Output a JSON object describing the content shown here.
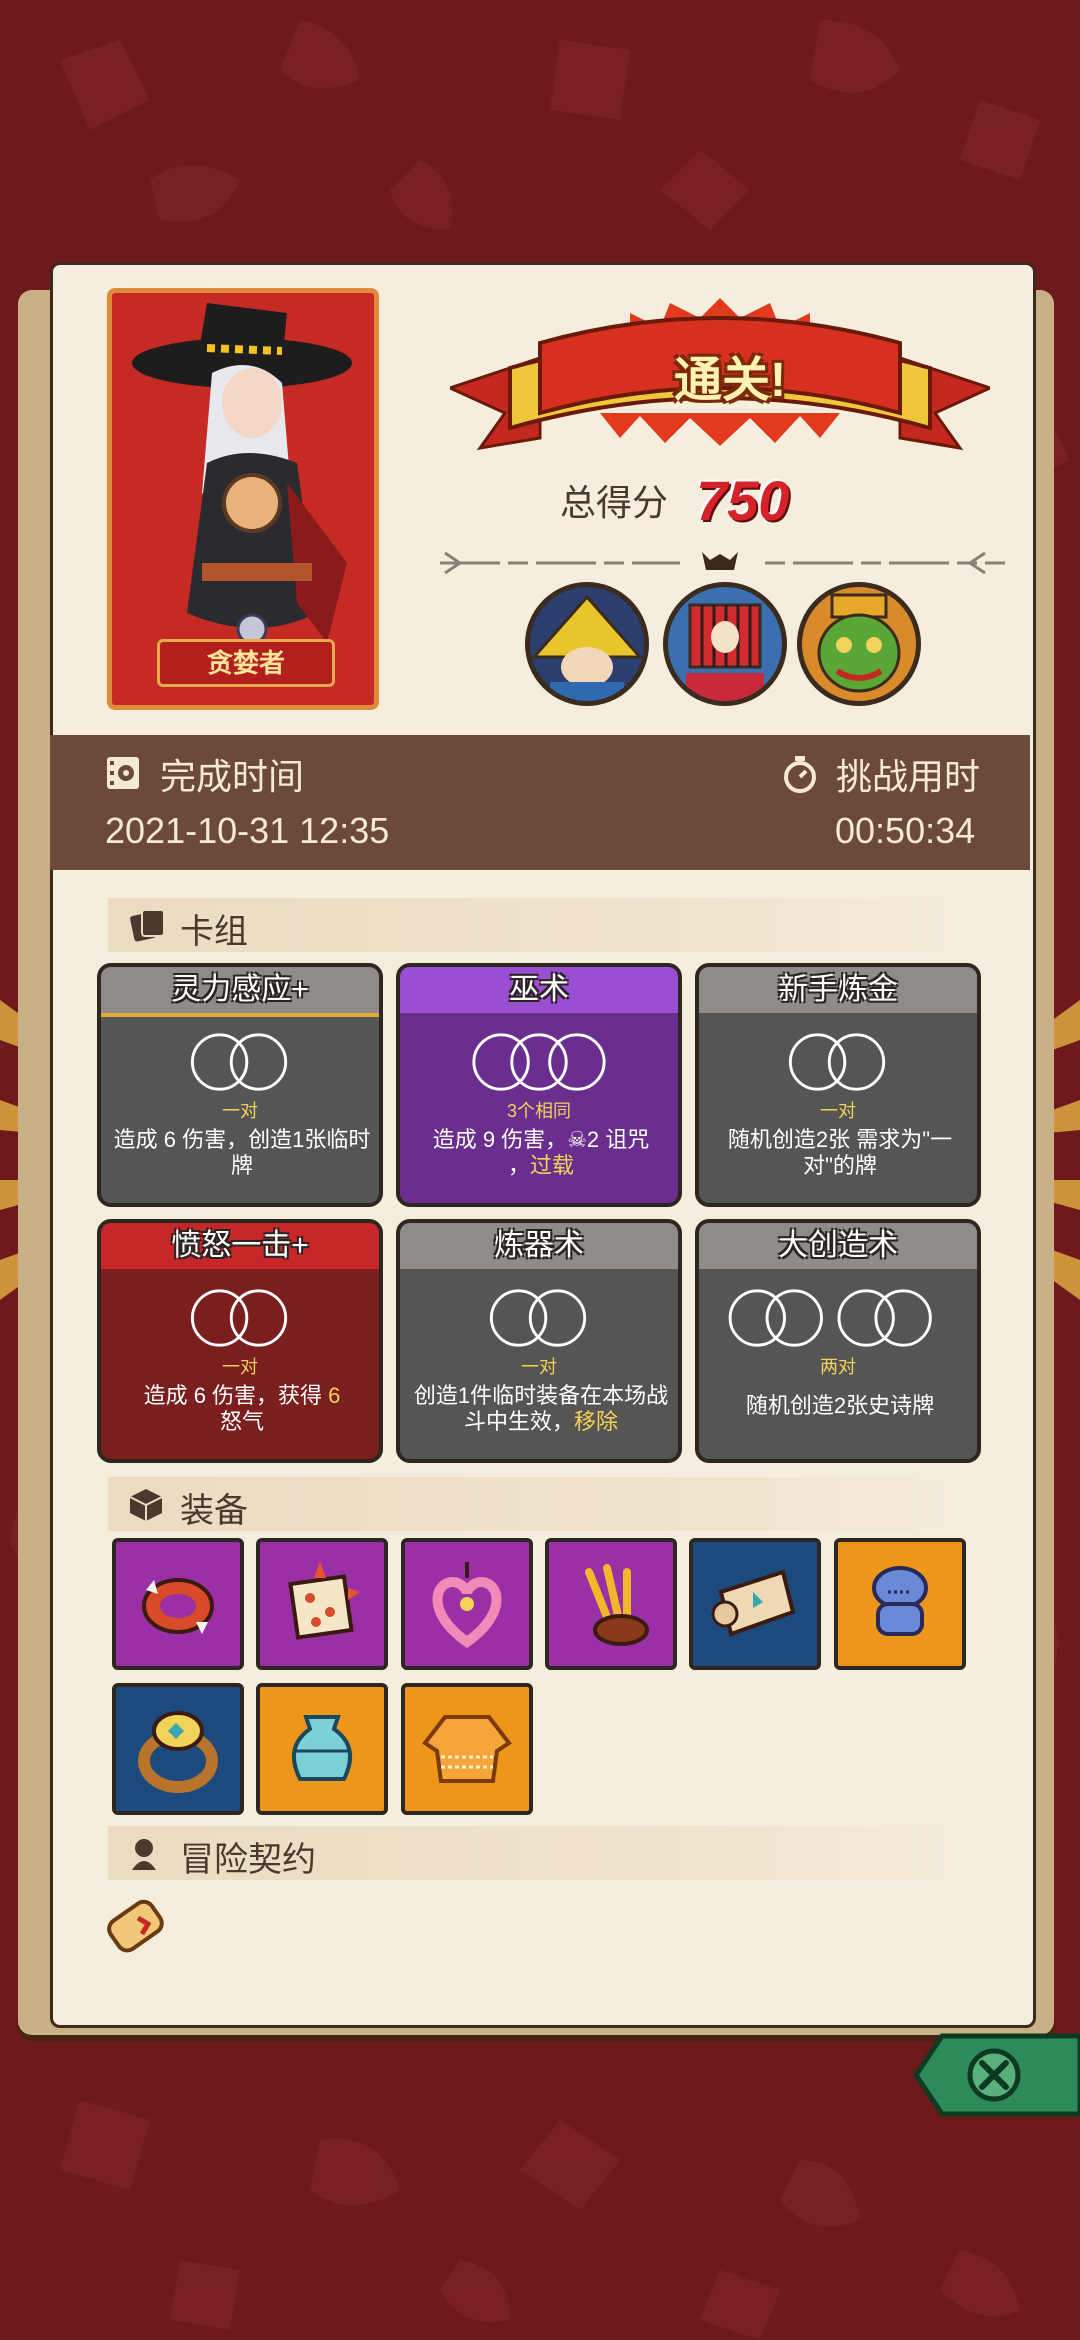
{
  "hero": {
    "name": "贪婪者"
  },
  "result": {
    "banner": "通关!",
    "score_label": "总得分",
    "score_value": "750"
  },
  "bosses": [
    "yellow-hat-boss",
    "red-cage-boss",
    "green-goblin-boss"
  ],
  "time": {
    "complete_label": "完成时间",
    "complete_value": "2021-10-31 12:35",
    "duration_label": "挑战用时",
    "duration_value": "00:50:34"
  },
  "deck": {
    "title": "卡组",
    "cards": [
      {
        "name": "灵力感应+",
        "tag": "一对",
        "desc": "造成 6 伤害，创造1张临时牌",
        "color": "gray"
      },
      {
        "name": "巫术",
        "tag": "3个相同",
        "desc_a": "造成 9 伤害，",
        "desc_b": "2 诅咒",
        "desc_c": "，",
        "desc_hl": "过载",
        "color": "purple"
      },
      {
        "name": "新手炼金",
        "tag": "一对",
        "desc": "随机创造2张 需求为\"一对\"的牌",
        "color": "gray"
      },
      {
        "name": "愤怒一击+",
        "tag": "一对",
        "desc_a": "造成 6 伤害，获得 ",
        "desc_hl": "6",
        "desc_b": "怒气",
        "color": "red"
      },
      {
        "name": "炼器术",
        "tag": "一对",
        "desc_a": "创造1件临时装备在本场战斗中生效，",
        "desc_hl": "移除",
        "color": "gray"
      },
      {
        "name": "大创造术",
        "tag": "两对",
        "desc": "随机创造2张史诗牌",
        "color": "gray"
      }
    ]
  },
  "equipment": {
    "title": "装备",
    "items": [
      {
        "icon": "spiked-cuff-icon",
        "bg": "purple"
      },
      {
        "icon": "spiked-dice-icon",
        "bg": "purple"
      },
      {
        "icon": "heart-amulet-icon",
        "bg": "purple"
      },
      {
        "icon": "claw-gauntlet-icon",
        "bg": "purple"
      },
      {
        "icon": "scroll-map-icon",
        "bg": "blue"
      },
      {
        "icon": "voodoo-doll-icon",
        "bg": "orange"
      },
      {
        "icon": "gold-ring-icon",
        "bg": "blue"
      },
      {
        "icon": "teal-vase-icon",
        "bg": "orange"
      },
      {
        "icon": "orange-sweater-icon",
        "bg": "orange"
      }
    ]
  },
  "contract": {
    "title": "冒险契约",
    "items": [
      "rolled-scroll-icon"
    ]
  },
  "colors": {
    "accent_red": "#d8222a",
    "panel": "#f6eedd",
    "time_bar": "#6b4a39",
    "gold_text": "#f2d35a"
  }
}
